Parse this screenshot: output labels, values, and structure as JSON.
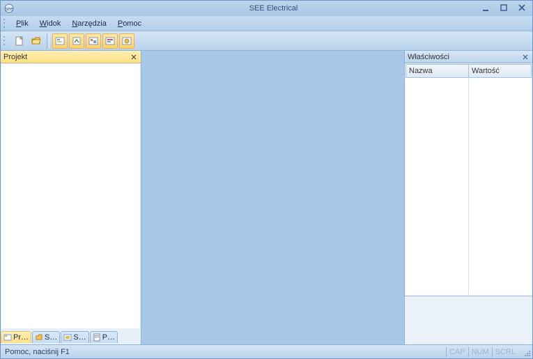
{
  "app": {
    "title": "SEE Electrical"
  },
  "menu": {
    "file": "Plik",
    "view": "Widok",
    "tools": "Narzędzia",
    "help": "Pomoc"
  },
  "panels": {
    "project_title": "Projekt",
    "properties_title": "Właściwości"
  },
  "properties": {
    "col_name": "Nazwa",
    "col_value": "Wartość"
  },
  "left_tabs": {
    "t1": "Pr…",
    "t2": "S…",
    "t3": "S…",
    "t4": "P…"
  },
  "status": {
    "help": "Pomoc, naciśnij F1",
    "cap": "CAP",
    "num": "NUM",
    "scrl": "SCRL"
  }
}
